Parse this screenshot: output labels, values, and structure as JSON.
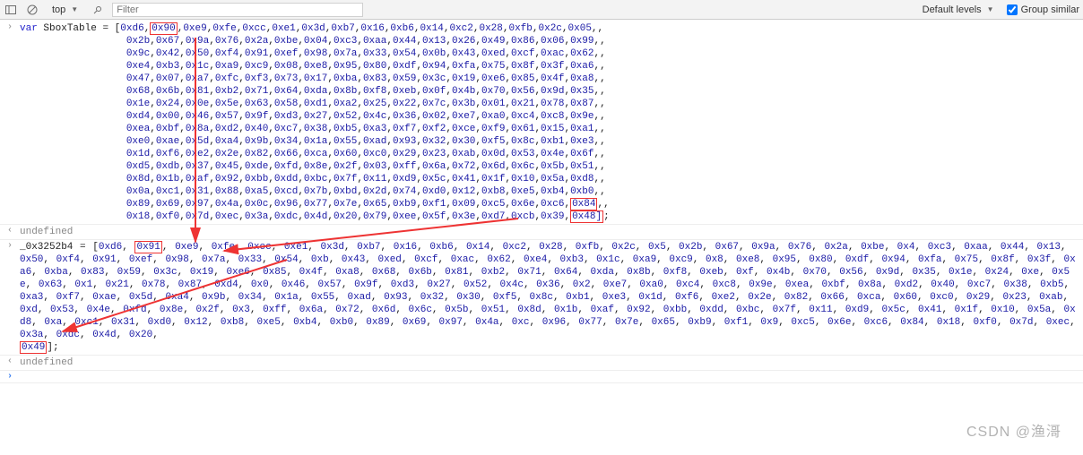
{
  "toolbar": {
    "context": "top",
    "filter_placeholder": "Filter",
    "levels": "Default levels",
    "group_similar": "Group similar"
  },
  "code1": {
    "keyword": "var",
    "varname": "SboxTable",
    "eq": "=",
    "open": "[",
    "close": "];",
    "rows": [
      "0xd6,0x90,0xe9,0xfe,0xcc,0xe1,0x3d,0xb7,0x16,0xb6,0x14,0xc2,0x28,0xfb,0x2c,0x05,",
      "0x2b,0x67,0x9a,0x76,0x2a,0xbe,0x04,0xc3,0xaa,0x44,0x13,0x26,0x49,0x86,0x06,0x99,",
      "0x9c,0x42,0x50,0xf4,0x91,0xef,0x98,0x7a,0x33,0x54,0x0b,0x43,0xed,0xcf,0xac,0x62,",
      "0xe4,0xb3,0x1c,0xa9,0xc9,0x08,0xe8,0x95,0x80,0xdf,0x94,0xfa,0x75,0x8f,0x3f,0xa6,",
      "0x47,0x07,0xa7,0xfc,0xf3,0x73,0x17,0xba,0x83,0x59,0x3c,0x19,0xe6,0x85,0x4f,0xa8,",
      "0x68,0x6b,0x81,0xb2,0x71,0x64,0xda,0x8b,0xf8,0xeb,0x0f,0x4b,0x70,0x56,0x9d,0x35,",
      "0x1e,0x24,0x0e,0x5e,0x63,0x58,0xd1,0xa2,0x25,0x22,0x7c,0x3b,0x01,0x21,0x78,0x87,",
      "0xd4,0x00,0x46,0x57,0x9f,0xd3,0x27,0x52,0x4c,0x36,0x02,0xe7,0xa0,0xc4,0xc8,0x9e,",
      "0xea,0xbf,0x8a,0xd2,0x40,0xc7,0x38,0xb5,0xa3,0xf7,0xf2,0xce,0xf9,0x61,0x15,0xa1,",
      "0xe0,0xae,0x5d,0xa4,0x9b,0x34,0x1a,0x55,0xad,0x93,0x32,0x30,0xf5,0x8c,0xb1,0xe3,",
      "0x1d,0xf6,0xe2,0x2e,0x82,0x66,0xca,0x60,0xc0,0x29,0x23,0xab,0x0d,0x53,0x4e,0x6f,",
      "0xd5,0xdb,0x37,0x45,0xde,0xfd,0x8e,0x2f,0x03,0xff,0x6a,0x72,0x6d,0x6c,0x5b,0x51,",
      "0x8d,0x1b,0xaf,0x92,0xbb,0xdd,0xbc,0x7f,0x11,0xd9,0x5c,0x41,0x1f,0x10,0x5a,0xd8,",
      "0x0a,0xc1,0x31,0x88,0xa5,0xcd,0x7b,0xbd,0x2d,0x74,0xd0,0x12,0xb8,0xe5,0xb4,0xb0,",
      "0x89,0x69,0x97,0x4a,0x0c,0x96,0x77,0x7e,0x65,0xb9,0xf1,0x09,0xc5,0x6e,0xc6,0x84,",
      "0x18,0xf0,0x7d,0xec,0x3a,0xdc,0x4d,0x20,0x79,0xee,0x5f,0x3e,0xd7,0xcb,0x39,0x48"
    ],
    "highlight_first_row": "0x90",
    "highlight_last_tokens": [
      "0x84",
      "0x48]"
    ]
  },
  "result1": "undefined",
  "code2": {
    "varname": "_0x3252b4",
    "eq": "=",
    "open": "[",
    "first_token": "0xd6",
    "hl_second": "0x91",
    "mid_tail": "0xe9, 0xfe, 0xcc, 0xe1, 0x3d, 0xb7, 0x16, 0xb6, 0x14, 0xc2, 0x28, 0xfb, 0x2c, 0x5, 0x2b, 0x67, 0x9a, 0x76, 0x2a, 0xbe, 0x4, 0xc3, 0xaa, 0x44, 0x13, 0x50, 0xf4, 0x91, 0xef, 0x98, 0x7a, 0x33, 0x54, 0xb, 0x43, 0xed, 0xcf, 0xac, 0x62, 0xe4, 0xb3, 0x1c, 0xa9, 0xc9, 0x8, 0xe8, 0x95, 0x80, 0xdf, 0x94, 0xfa, 0x75, 0x8f, 0x3f, 0xa6, 0xba, 0x83, 0x59, 0x3c, 0x19, 0xe6, 0x85, 0x4f, 0xa8, 0x68, 0x6b, 0x81, 0xb2, 0x71, 0x64, 0xda, 0x8b, 0xf8, 0xeb, 0xf, 0x4b, 0x70, 0x56, 0x9d, 0x35, 0x1e, 0x24, 0xe, 0x5e, 0x63, 0x1, 0x21, 0x78, 0x87, 0xd4, 0x0, 0x46, 0x57, 0x9f, 0xd3, 0x27, 0x52, 0x4c, 0x36, 0x2, 0xe7, 0xa0, 0xc4, 0xc8, 0x9e, 0xea, 0xbf, 0x8a, 0xd2, 0x40, 0xc7, 0x38, 0xb5, 0xa3, 0xf7, 0xae, 0x5d, 0xa4, 0x9b, 0x34, 0x1a, 0x55, 0xad, 0x93, 0x32, 0x30, 0xf5, 0x8c, 0xb1, 0xe3, 0x1d, 0xf6, 0xe2, 0x2e, 0x82, 0x66, 0xca, 0x60, 0xc0, 0x29, 0x23, 0xab, 0xd, 0x53, 0x4e, 0xfd, 0x8e, 0x2f, 0x3, 0xff, 0x6a, 0x72, 0x6d, 0x6c, 0x5b, 0x51, 0x8d, 0x1b, 0xaf, 0x92, 0xbb, 0xdd, 0xbc, 0x7f, 0x11, 0xd9, 0x5c, 0x41, 0x1f, 0x10, 0x5a, 0xd8, 0xa, 0xc1, 0x31, 0xd0, 0x12, 0xb8, 0xe5, 0xb4, 0xb0, 0x89, 0x69, 0x97, 0x4a, 0xc, 0x96, 0x77, 0x7e, 0x65, 0xb9, 0xf1, 0x9, 0xc5, 0x6e, 0xc6, 0x84, 0x18, 0xf0, 0x7d, 0xec, 0x3a, 0xdc, 0x4d, 0x20, ",
    "hl_last": "0x49",
    "close": "];"
  },
  "result2": "undefined",
  "watermark": "CSDN @渔滒"
}
